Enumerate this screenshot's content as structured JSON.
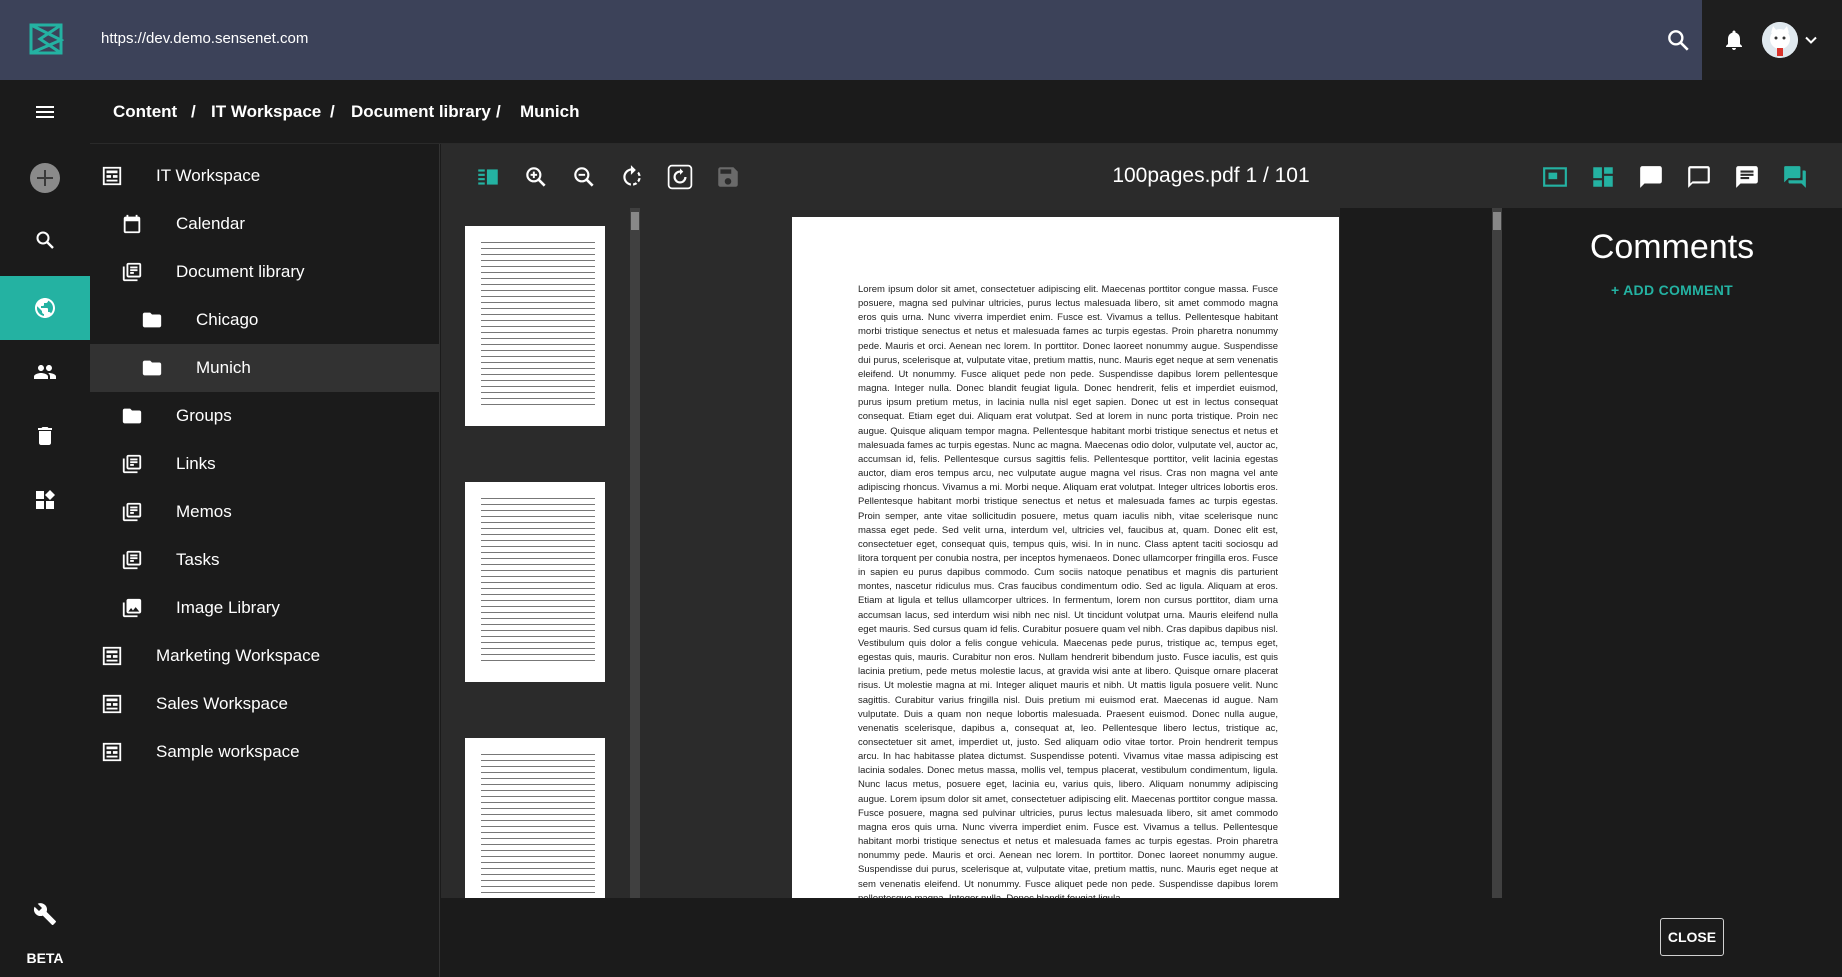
{
  "header": {
    "url": "https://dev.demo.sensenet.com",
    "accent": "#24b2a2",
    "bar_color": "#3c4259"
  },
  "rail": {
    "items": [
      "menu-icon",
      "add-icon",
      "search-icon",
      "globe-icon",
      "users-icon",
      "trash-icon",
      "dashboard-icon",
      "wrench-icon"
    ],
    "active": "globe-icon",
    "beta_label": "BETA"
  },
  "breadcrumb": {
    "items": [
      "Content",
      "IT Workspace",
      "Document library",
      "Munich"
    ],
    "separator": "/"
  },
  "tree": {
    "items": [
      {
        "label": "IT Workspace",
        "icon": "workspace-icon"
      },
      {
        "label": "Calendar",
        "icon": "calendar-icon"
      },
      {
        "label": "Document library",
        "icon": "library-icon"
      },
      {
        "label": "Chicago",
        "icon": "folder-icon"
      },
      {
        "label": "Munich",
        "icon": "folder-icon",
        "selected": true
      },
      {
        "label": "Groups",
        "icon": "folder-icon"
      },
      {
        "label": "Links",
        "icon": "list-icon"
      },
      {
        "label": "Memos",
        "icon": "list-icon"
      },
      {
        "label": "Tasks",
        "icon": "list-icon"
      },
      {
        "label": "Image Library",
        "icon": "image-library-icon"
      },
      {
        "label": "Marketing Workspace",
        "icon": "workspace-icon"
      },
      {
        "label": "Sales Workspace",
        "icon": "workspace-icon"
      },
      {
        "label": "Sample workspace",
        "icon": "workspace-icon"
      }
    ]
  },
  "viewer": {
    "title": "100pages.pdf 1 / 101",
    "toolbar_left": [
      "thumbnails-toggle-icon",
      "zoom-in-icon",
      "zoom-out-icon",
      "rotate-icon",
      "rotate-page-icon",
      "save-icon"
    ],
    "toolbar_right": [
      "fit-page-icon",
      "layout-icon",
      "comment-icon",
      "comment-outline-icon",
      "comment-text-icon",
      "comments-panel-icon"
    ],
    "page_text": "Lorem ipsum dolor sit amet, consectetuer adipiscing elit. Maecenas porttitor congue massa. Fusce posuere, magna sed pulvinar ultricies, purus lectus malesuada libero, sit amet commodo magna eros quis urna. Nunc viverra imperdiet enim. Fusce est. Vivamus a tellus. Pellentesque habitant morbi tristique senectus et netus et malesuada fames ac turpis egestas. Proin pharetra nonummy pede. Mauris et orci. Aenean nec lorem. In porttitor. Donec laoreet nonummy augue. Suspendisse dui purus, scelerisque at, vulputate vitae, pretium mattis, nunc. Mauris eget neque at sem venenatis eleifend. Ut nonummy. Fusce aliquet pede non pede. Suspendisse dapibus lorem pellentesque magna. Integer nulla. Donec blandit feugiat ligula. Donec hendrerit, felis et imperdiet euismod, purus ipsum pretium metus, in lacinia nulla nisl eget sapien. Donec ut est in lectus consequat consequat. Etiam eget dui. Aliquam erat volutpat. Sed at lorem in nunc porta tristique. Proin nec augue. Quisque aliquam tempor magna. Pellentesque habitant morbi tristique senectus et netus et malesuada fames ac turpis egestas. Nunc ac magna. Maecenas odio dolor, vulputate vel, auctor ac, accumsan id, felis. Pellentesque cursus sagittis felis. Pellentesque porttitor, velit lacinia egestas auctor, diam eros tempus arcu, nec vulputate augue magna vel risus. Cras non magna vel ante adipiscing rhoncus. Vivamus a mi. Morbi neque. Aliquam erat volutpat. Integer ultrices lobortis eros. Pellentesque habitant morbi tristique senectus et netus et malesuada fames ac turpis egestas. Proin semper, ante vitae sollicitudin posuere, metus quam iaculis nibh, vitae scelerisque nunc massa eget pede. Sed velit urna, interdum vel, ultricies vel, faucibus at, quam. Donec elit est, consectetuer eget, consequat quis, tempus quis, wisi. In in nunc. Class aptent taciti sociosqu ad litora torquent per conubia nostra, per inceptos hymenaeos. Donec ullamcorper fringilla eros. Fusce in sapien eu purus dapibus commodo. Cum sociis natoque penatibus et magnis dis parturient montes, nascetur ridiculus mus. Cras faucibus condimentum odio. Sed ac ligula. Aliquam at eros. Etiam at ligula et tellus ullamcorper ultrices. In fermentum, lorem non cursus porttitor, diam urna accumsan lacus, sed interdum wisi nibh nec nisl. Ut tincidunt volutpat urna. Mauris eleifend nulla eget mauris. Sed cursus quam id felis. Curabitur posuere quam vel nibh. Cras dapibus dapibus nisl. Vestibulum quis dolor a felis congue vehicula. Maecenas pede purus, tristique ac, tempus eget, egestas quis, mauris. Curabitur non eros. Nullam hendrerit bibendum justo. Fusce iaculis, est quis lacinia pretium, pede metus molestie lacus, at gravida wisi ante at libero. Quisque ornare placerat risus. Ut molestie magna at mi. Integer aliquet mauris et nibh. Ut mattis ligula posuere velit. Nunc sagittis. Curabitur varius fringilla nisl. Duis pretium mi euismod erat. Maecenas id augue. Nam vulputate. Duis a quam non neque lobortis malesuada. Praesent euismod. Donec nulla augue, venenatis scelerisque, dapibus a, consequat at, leo. Pellentesque libero lectus, tristique ac, consectetuer sit amet, imperdiet ut, justo. Sed aliquam odio vitae tortor. Proin hendrerit tempus arcu. In hac habitasse platea dictumst. Suspendisse potenti. Vivamus vitae massa adipiscing est lacinia sodales. Donec metus massa, mollis vel, tempus placerat, vestibulum condimentum, ligula. Nunc lacus metus, posuere eget, lacinia eu, varius quis, libero. Aliquam nonummy adipiscing augue. Lorem ipsum dolor sit amet, consectetuer adipiscing elit. Maecenas porttitor congue massa. Fusce posuere, magna sed pulvinar ultricies, purus lectus malesuada libero, sit amet commodo magna eros quis urna. Nunc viverra imperdiet enim. Fusce est. Vivamus a tellus. Pellentesque habitant morbi tristique senectus et netus et malesuada fames ac turpis egestas. Proin pharetra nonummy pede. Mauris et orci. Aenean nec lorem. In porttitor. Donec laoreet nonummy augue. Suspendisse dui purus, scelerisque at, vulputate vitae, pretium mattis, nunc. Mauris eget neque at sem venenatis eleifend. Ut nonummy. Fusce aliquet pede non pede. Suspendisse dapibus lorem pellentesque magna. Integer nulla. Donec blandit feugiat ligula."
  },
  "comments": {
    "title": "Comments",
    "add_label": "+ ADD COMMENT"
  },
  "close_label": "CLOSE"
}
